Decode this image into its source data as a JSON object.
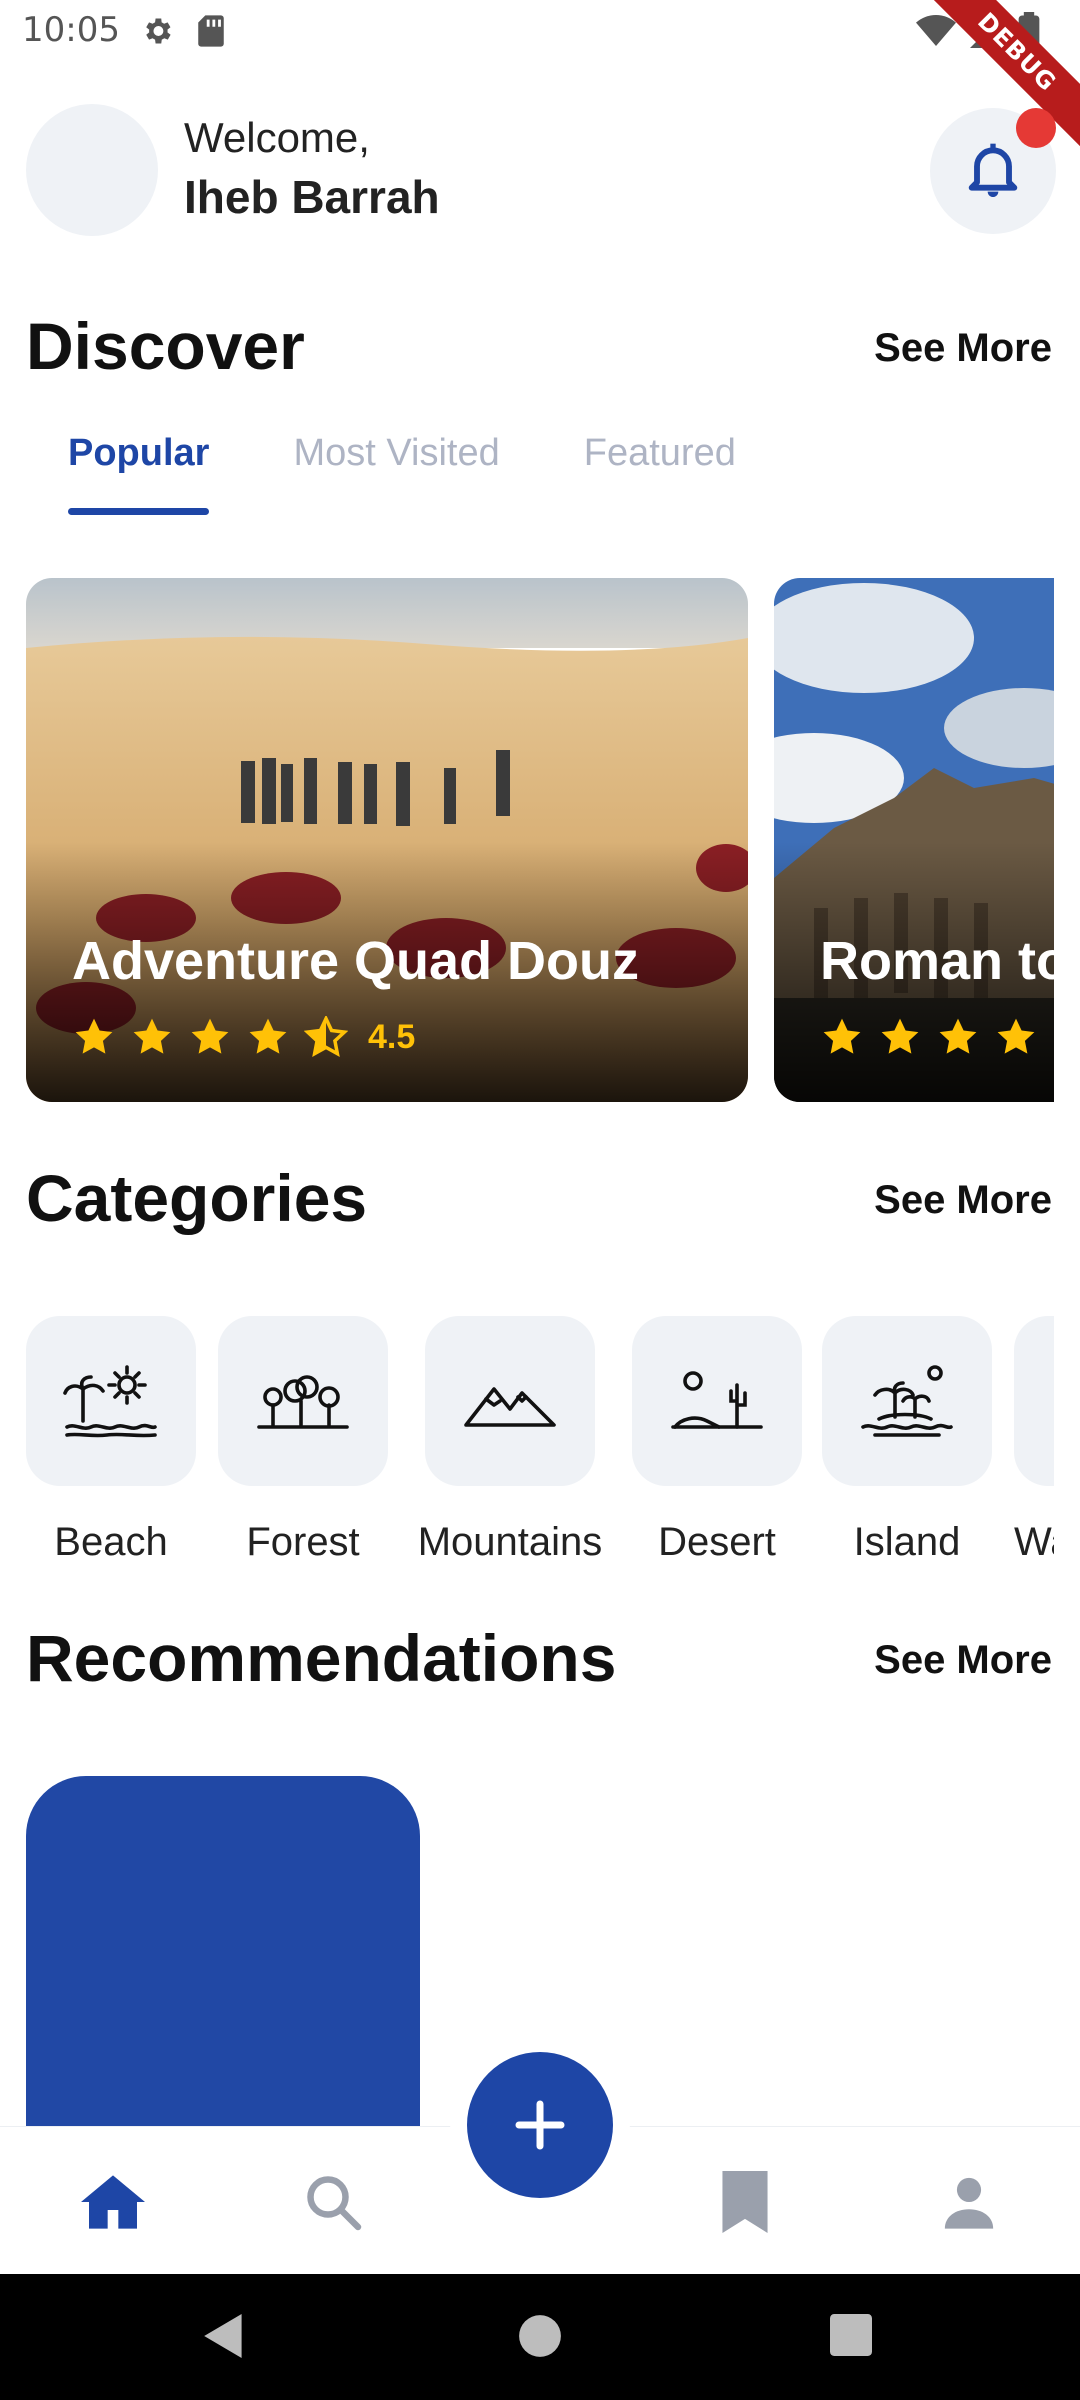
{
  "status_bar": {
    "time": "10:05",
    "icons": [
      "gear-icon",
      "sd-card-icon",
      "wifi-icon",
      "signal-icon",
      "battery-icon"
    ]
  },
  "debug_banner": "DEBUG",
  "header": {
    "welcome": "Welcome,",
    "username": "Iheb Barrah",
    "notification_icon": "bell-icon",
    "has_unread": true
  },
  "discover": {
    "title": "Discover",
    "see_more": "See More",
    "tabs": [
      {
        "label": "Popular",
        "active": true
      },
      {
        "label": "Most Visited",
        "active": false
      },
      {
        "label": "Featured",
        "active": false
      }
    ],
    "cards": [
      {
        "title": "Adventure Quad Douz",
        "rating": "4.5",
        "stars": 4.5
      },
      {
        "title": "Roman to",
        "rating": "",
        "stars": 4
      }
    ]
  },
  "categories": {
    "title": "Categories",
    "see_more": "See More",
    "items": [
      {
        "label": "Beach",
        "icon": "beach-icon"
      },
      {
        "label": "Forest",
        "icon": "forest-icon"
      },
      {
        "label": "Mountains",
        "icon": "mountains-icon"
      },
      {
        "label": "Desert",
        "icon": "desert-icon"
      },
      {
        "label": "Island",
        "icon": "island-icon"
      },
      {
        "label": "Wa",
        "icon": "waterfall-icon"
      }
    ]
  },
  "recommendations": {
    "title": "Recommendations",
    "see_more": "See More"
  },
  "bottom_nav": {
    "items": [
      "home-icon",
      "search-icon",
      "add-icon",
      "bookmark-icon",
      "profile-icon"
    ],
    "active": "home-icon"
  },
  "colors": {
    "primary": "#1e46a6",
    "tile_bg": "#eff2f6",
    "star": "#ffc107",
    "notification_dot": "#e53935"
  }
}
